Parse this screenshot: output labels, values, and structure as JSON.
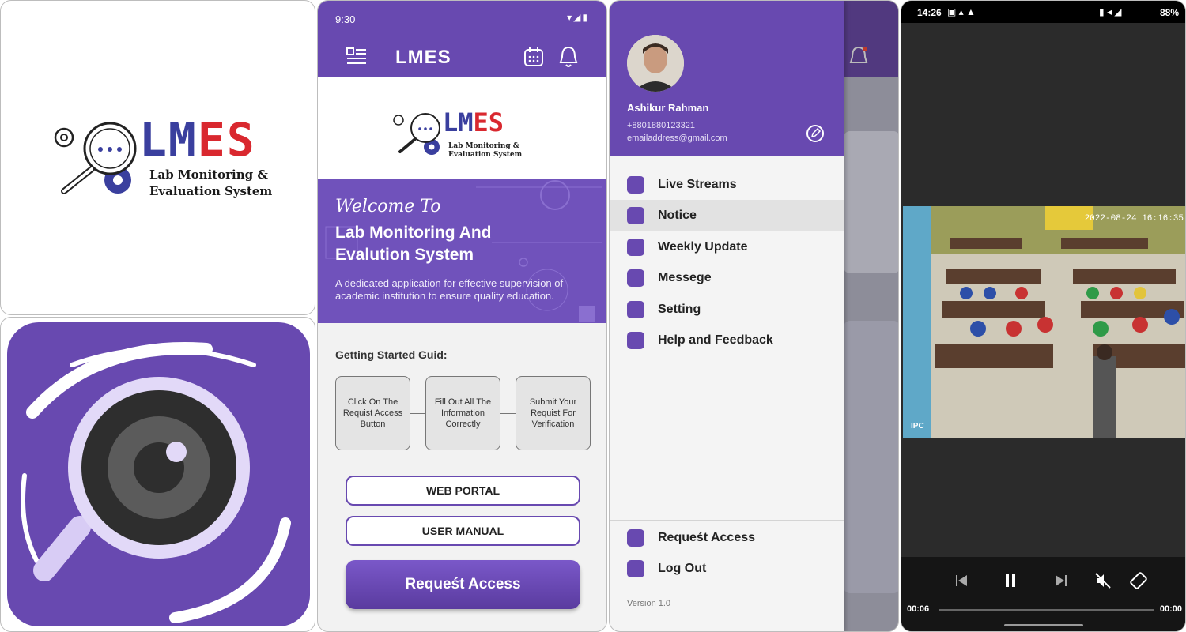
{
  "logo_tile": {
    "wordmark_l": "LM",
    "wordmark_r": "ES",
    "subtitle_1": "Lab Monitoring &",
    "subtitle_2": "Evaluation System"
  },
  "app_icon": {
    "icon": "camera-lens-magnifier-icon",
    "bg_color": "#6849b0"
  },
  "home": {
    "status_time": "9:30",
    "app_title": "LMES",
    "brand_wordmark_l": "LM",
    "brand_wordmark_r": "ES",
    "brand_sub_1": "Lab Monitoring &",
    "brand_sub_2": "Evaluation System",
    "welcome": "Welcome To",
    "hero_title": "Lab Monitoring And Evalution System",
    "hero_desc": "A dedicated application for effective supervision of academic institution to ensure quality education.",
    "guide_title": "Getting Started Guid:",
    "steps": [
      "Click On The Requist Access Button",
      "Fill Out All The Information Correctly",
      "Submit Your Requist For Verification"
    ],
    "web_portal": "WEB PORTAL",
    "user_manual": "USER MANUAL",
    "request_access": "Requeśt Access"
  },
  "drawer": {
    "name": "Ashikur Rahman",
    "phone": "+8801880123321",
    "email": "emailaddress@gmail.com",
    "items": [
      {
        "label": "Live Streams",
        "icon": "live-stream-icon"
      },
      {
        "label": "Notice",
        "icon": "notice-icon"
      },
      {
        "label": "Weekly Update",
        "icon": "calendar-icon"
      },
      {
        "label": "Messege",
        "icon": "message-icon"
      },
      {
        "label": "Setting",
        "icon": "gear-icon"
      },
      {
        "label": "Help and Feedback",
        "icon": "help-icon"
      }
    ],
    "active_item": "Notice",
    "bottom_items": [
      {
        "label": "Requeśt Access",
        "icon": "request-icon"
      },
      {
        "label": "Log Out",
        "icon": "logout-icon"
      }
    ],
    "version": "Version 1.0"
  },
  "video": {
    "status_time": "14:26",
    "status_battery": "88%",
    "timestamp": "2022-08-24 16:16:35",
    "watermark": "IPC",
    "elapsed": "00:06",
    "remaining": "00:00"
  },
  "colors": {
    "primary": "#6849b0",
    "logo_blue": "#3a3f9e",
    "logo_red": "#d9282f"
  }
}
